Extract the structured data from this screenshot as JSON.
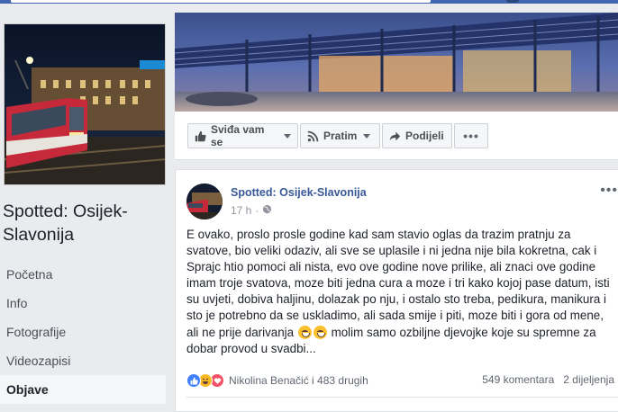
{
  "page": {
    "name": "Spotted: Osijek-Slavonija"
  },
  "nav": {
    "items": [
      {
        "label": "Početna"
      },
      {
        "label": "Info"
      },
      {
        "label": "Fotografije"
      },
      {
        "label": "Videozapisi"
      },
      {
        "label": "Objave",
        "active": true
      }
    ]
  },
  "actions": {
    "like_label": "Sviđa vam se",
    "follow_label": "Pratim",
    "share_label": "Podijeli",
    "more_label": "•••"
  },
  "post": {
    "author": "Spotted: Osijek-Slavonija",
    "time": "17 h",
    "more_label": "•••",
    "text_before_emoji": "E ovako, proslo prosle godine kad sam stavio oglas da trazim pratnju za svatove, bio veliki odaziv, ali sve se uplasile i ni jedna nije bila kokretna, cak i Sprajc htio pomoci ali nista, evo ove godine nove prilike, ali znaci ove godine imam troje svatova, moze biti jedna cura a moze i tri kako kojoj pase datum, isti su uvjeti, dobiva haljinu, dolazak po nju, i ostalo sto treba, pedikura, manikura i sto je potrebno da se uskladimo, ali sada smije i piti, moze biti i gora od mene, ali ne prije darivanja",
    "text_after_emoji": " molim samo ozbiljne djevojke koje su spremne za dobar provod u svadbi...",
    "reactions_text": "Nikolina Benačić i 483 drugih",
    "comments": "549 komentara",
    "shares": "2 dijeljenja"
  },
  "colors": {
    "topbar": "#4267b2",
    "link": "#385898",
    "like_reaction": "#4080ff",
    "haha_reaction": "#f7b928",
    "love_reaction": "#f25268"
  },
  "icons": {
    "like": "thumbs-up-icon",
    "follow": "rss-icon",
    "share": "share-arrow-icon",
    "audience": "globe-icon"
  }
}
